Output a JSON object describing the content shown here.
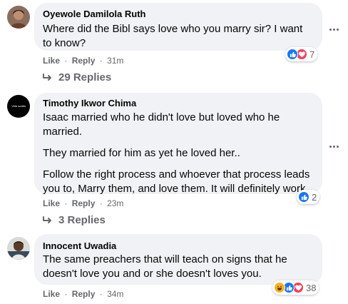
{
  "comments": [
    {
      "author": "Oyewole Damilola Ruth",
      "text": "Where did the Bibl says love who you marry sir? I want to know?",
      "like_label": "Like",
      "reply_label": "Reply",
      "separator": "·",
      "time": "31m",
      "reaction_icons": [
        "like-icon",
        "love-icon"
      ],
      "reaction_count": "7",
      "replies_label": "29 Replies"
    },
    {
      "author": "Timothy Ikwor Chima",
      "avatar_text": "Vida sudita",
      "paragraphs": [
        "Isaac married who he didn't love but loved who he married.",
        "They married for him as yet he loved her..",
        "Follow the right process and whoever that process leads you to, Marry them, and love them. It will definitely work"
      ],
      "like_label": "Like",
      "reply_label": "Reply",
      "separator": "·",
      "time": "23m",
      "reaction_icons": [
        "like-icon"
      ],
      "reaction_count": "2",
      "replies_label": "3 Replies"
    },
    {
      "author": "Innocent Uwadia",
      "text": "The same preachers that will teach on signs that he doesn't love you and or she doesn't loves you.",
      "like_label": "Like",
      "reply_label": "Reply",
      "separator": "·",
      "time": "34m",
      "reaction_icons": [
        "haha-icon",
        "like-icon",
        "love-icon"
      ],
      "reaction_count": "38"
    }
  ],
  "colors": {
    "bubble": "#f0f2f5",
    "meta_text": "#65676b",
    "like_blue": "#1877f2",
    "love_red": "#f33e58",
    "haha_yellow": "#f7b125"
  }
}
